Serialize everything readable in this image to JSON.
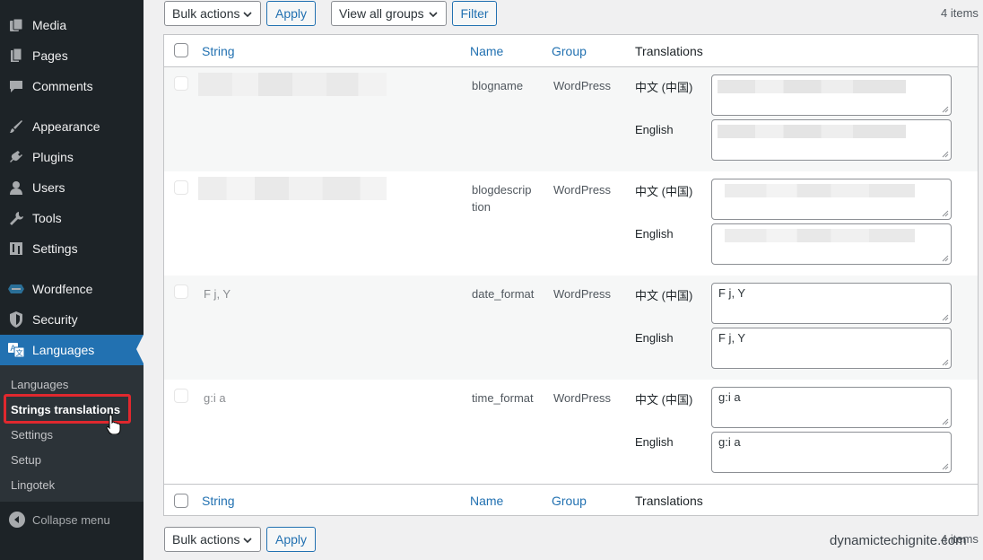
{
  "sidebar": {
    "menu": [
      {
        "label": "Media",
        "icon": "media-icon"
      },
      {
        "label": "Pages",
        "icon": "pages-icon"
      },
      {
        "label": "Comments",
        "icon": "comments-icon"
      },
      {
        "label": "Appearance",
        "icon": "appearance-icon"
      },
      {
        "label": "Plugins",
        "icon": "plugins-icon"
      },
      {
        "label": "Users",
        "icon": "users-icon"
      },
      {
        "label": "Tools",
        "icon": "tools-icon"
      },
      {
        "label": "Settings",
        "icon": "settings-icon"
      },
      {
        "label": "Wordfence",
        "icon": "wordfence-icon"
      },
      {
        "label": "Security",
        "icon": "shield-icon"
      },
      {
        "label": "Languages",
        "icon": "languages-icon"
      }
    ],
    "submenu": [
      "Languages",
      "Strings translations",
      "Settings",
      "Setup",
      "Lingotek"
    ],
    "collapse": "Collapse menu",
    "accent": "#2271b1",
    "highlight_color": "#e0282e"
  },
  "top": {
    "bulk_actions": "Bulk actions",
    "apply": "Apply",
    "groups": "View all groups",
    "filter": "Filter",
    "count": "4 items"
  },
  "bottom": {
    "bulk_actions": "Bulk actions",
    "apply": "Apply",
    "count": "4 items"
  },
  "table": {
    "columns": {
      "string": "String",
      "name": "Name",
      "group": "Group",
      "translations": "Translations"
    },
    "rows": [
      {
        "string": "",
        "name": "blogname",
        "group": "WordPress",
        "lang1": "中文 (中国)",
        "val1": "",
        "lang2": "English",
        "val2": ""
      },
      {
        "string": "",
        "name": "blogdescrip tion",
        "group": "WordPress",
        "lang1": "中文 (中国)",
        "val1": "",
        "lang2": "English",
        "val2": ""
      },
      {
        "string": "F j, Y",
        "name": "date_format",
        "group": "WordPress",
        "lang1": "中文 (中国)",
        "val1": "F j, Y",
        "lang2": "English",
        "val2": "F j, Y"
      },
      {
        "string": "g:i a",
        "name": "time_format",
        "group": "WordPress",
        "lang1": "中文 (中国)",
        "val1": "g:i a",
        "lang2": "English",
        "val2": "g:i a"
      }
    ]
  },
  "watermark": "dynamictechignite.com"
}
